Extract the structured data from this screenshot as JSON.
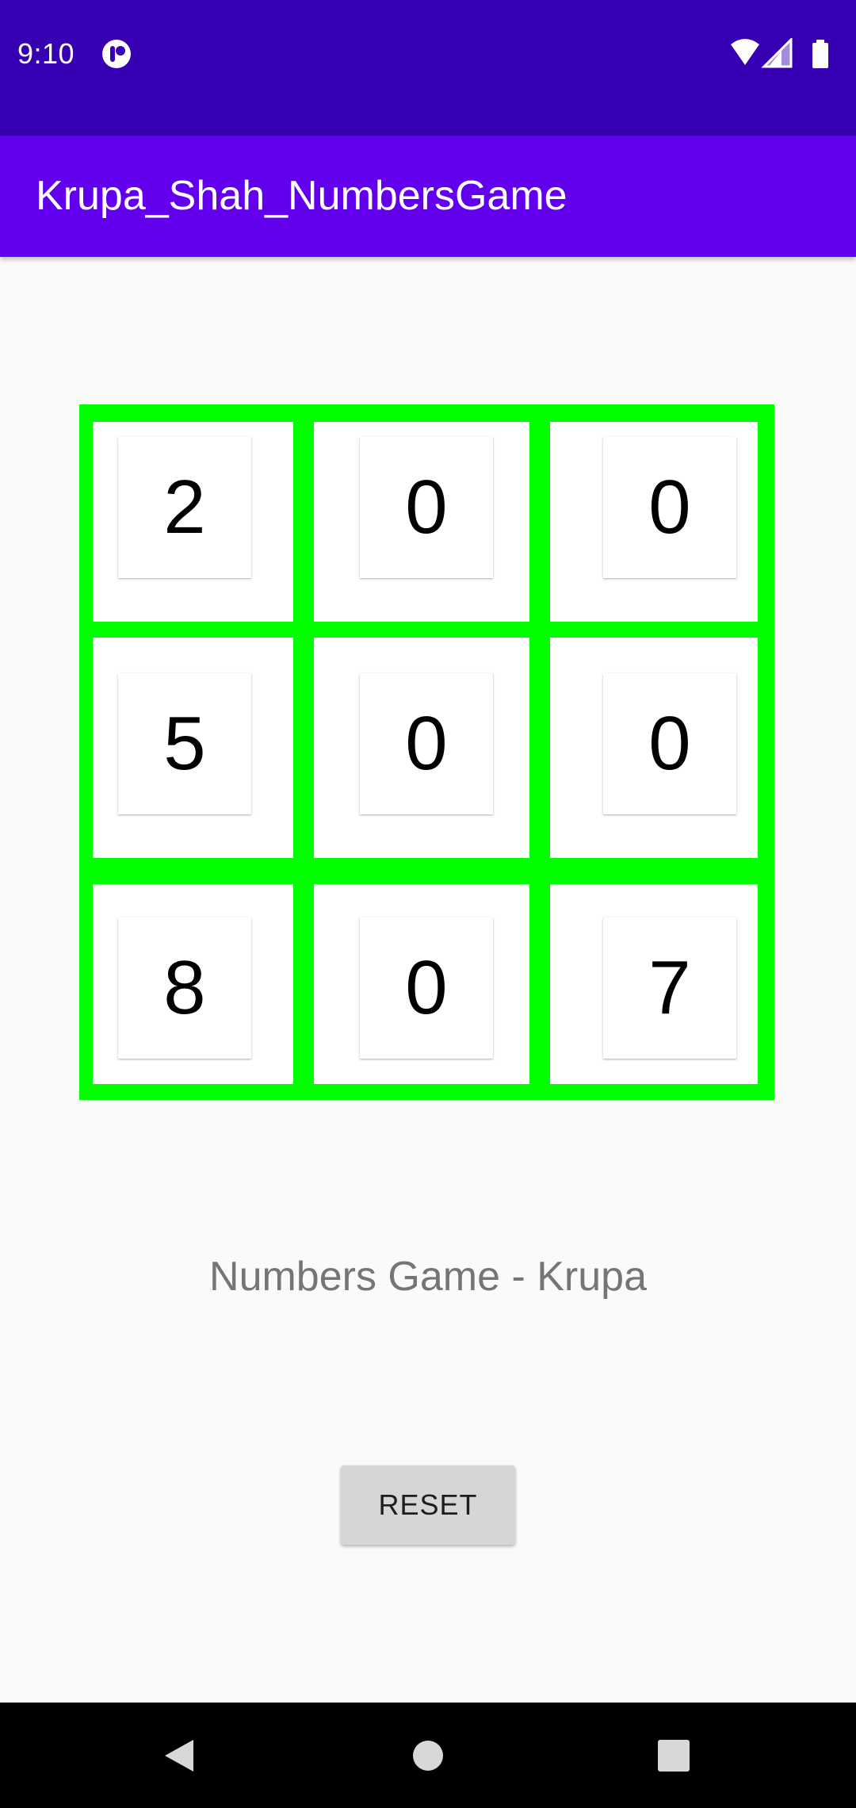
{
  "status_bar": {
    "time": "9:10",
    "icons": [
      "app-notification-icon",
      "wifi-icon",
      "cellular-signal-icon",
      "battery-icon"
    ]
  },
  "app_bar": {
    "title": "Krupa_Shah_NumbersGame"
  },
  "grid": {
    "border_color": "#00ff00",
    "rows": [
      [
        "2",
        "0",
        "0"
      ],
      [
        "5",
        "0",
        "0"
      ],
      [
        "8",
        "0",
        "7"
      ]
    ]
  },
  "caption": "Numbers Game - Krupa",
  "reset_button": {
    "label": "RESET"
  },
  "nav_bar": {
    "buttons": [
      "back-icon",
      "home-icon",
      "recents-icon"
    ]
  },
  "colors": {
    "status_bar": "#3700b3",
    "app_bar": "#6200ee",
    "background": "#fafafa"
  }
}
